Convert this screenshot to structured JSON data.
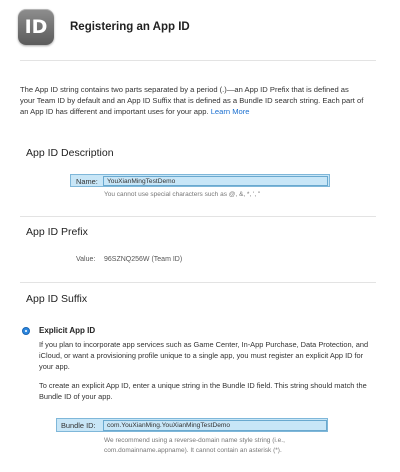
{
  "header": {
    "icon_text": "ID",
    "title": "Registering an App ID"
  },
  "intro": {
    "text": "The App ID string contains two parts separated by a period (.)—an App ID Prefix that is defined as your Team ID by default and an App ID Suffix that is defined as a Bundle ID search string. Each part of an App ID has different and important uses for your app.",
    "link": "Learn More"
  },
  "description": {
    "heading": "App ID Description",
    "name_label": "Name:",
    "name_value": "YouXianMingTestDemo",
    "hint": "You cannot use special characters such as @, &, *, ', \""
  },
  "prefix": {
    "heading": "App ID Prefix",
    "value_label": "Value:",
    "value": "96SZNQ256W (Team ID)"
  },
  "suffix": {
    "heading": "App ID Suffix",
    "explicit": {
      "title": "Explicit App ID",
      "para1": "If you plan to incorporate app services such as Game Center, In-App Purchase, Data Protection, and iCloud, or want a provisioning profile unique to a single app, you must register an explicit App ID for your app.",
      "para2": "To create an explicit App ID, enter a unique string in the Bundle ID field. This string should match the Bundle ID of your app.",
      "bundle_label": "Bundle ID:",
      "bundle_value": "com.YouXianMing.YouXianMingTestDemo",
      "bundle_hint_line1": "We recommend using a reverse-domain name style string (i.e.,",
      "bundle_hint_line2": "com.domainname.appname). It cannot contain an asterisk (*)."
    }
  },
  "colors": {
    "field_bg": "#c8e6f7",
    "link": "#1a6fd0",
    "radio": "#2d88e0"
  }
}
